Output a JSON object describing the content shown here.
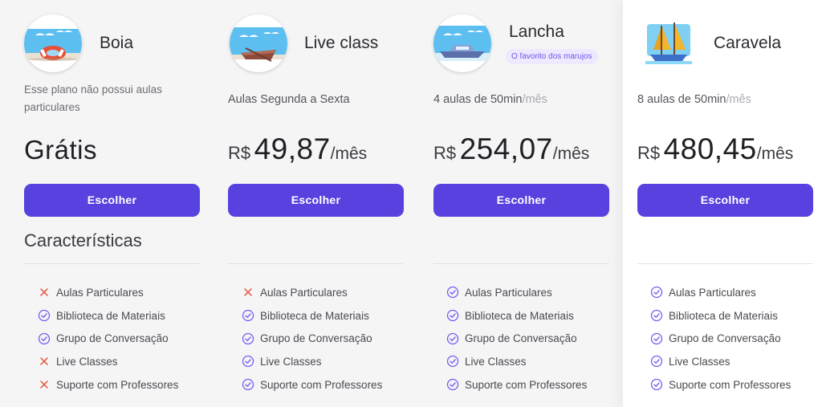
{
  "plans": [
    {
      "name": "Boia",
      "description": "Esse plano não possui aulas particulares",
      "price_full": "Grátis",
      "button": "Escolher",
      "features_title": "Características",
      "features": [
        {
          "label": "Aulas Particulares",
          "included": false
        },
        {
          "label": "Biblioteca de Materiais",
          "included": true
        },
        {
          "label": "Grupo de Conversação",
          "included": true
        },
        {
          "label": "Live Classes",
          "included": false
        },
        {
          "label": "Suporte com Professores",
          "included": false
        }
      ]
    },
    {
      "name": "Live class",
      "description": "Aulas Segunda a Sexta",
      "currency": "R$",
      "price": "49,87",
      "period": "/mês",
      "button": "Escolher",
      "features": [
        {
          "label": "Aulas Particulares",
          "included": false
        },
        {
          "label": "Biblioteca de Materiais",
          "included": true
        },
        {
          "label": "Grupo de Conversação",
          "included": true
        },
        {
          "label": "Live Classes",
          "included": true
        },
        {
          "label": "Suporte com Professores",
          "included": true
        }
      ]
    },
    {
      "name": "Lancha",
      "badge": "O favorito dos marujos",
      "description_main": "4 aulas de 50min",
      "description_muted": "/mês",
      "currency": "R$",
      "price": "254,07",
      "period": "/mês",
      "button": "Escolher",
      "features": [
        {
          "label": "Aulas Particulares",
          "included": true
        },
        {
          "label": "Biblioteca de Materiais",
          "included": true
        },
        {
          "label": "Grupo de Conversação",
          "included": true
        },
        {
          "label": "Live Classes",
          "included": true
        },
        {
          "label": "Suporte com Professores",
          "included": true
        }
      ]
    },
    {
      "name": "Caravela",
      "description_main": "8 aulas de 50min",
      "description_muted": "/mês",
      "currency": "R$",
      "price": "480,45",
      "period": "/mês",
      "button": "Escolher",
      "features": [
        {
          "label": "Aulas Particulares",
          "included": true
        },
        {
          "label": "Biblioteca de Materiais",
          "included": true
        },
        {
          "label": "Grupo de Conversação",
          "included": true
        },
        {
          "label": "Live Classes",
          "included": true
        },
        {
          "label": "Suporte com Professores",
          "included": true
        }
      ]
    }
  ],
  "colors": {
    "accent": "#5742e0",
    "check": "#7a5cf0",
    "cross": "#e5533d"
  },
  "icons": {
    "included": "check-circle-icon",
    "excluded": "x-icon"
  }
}
